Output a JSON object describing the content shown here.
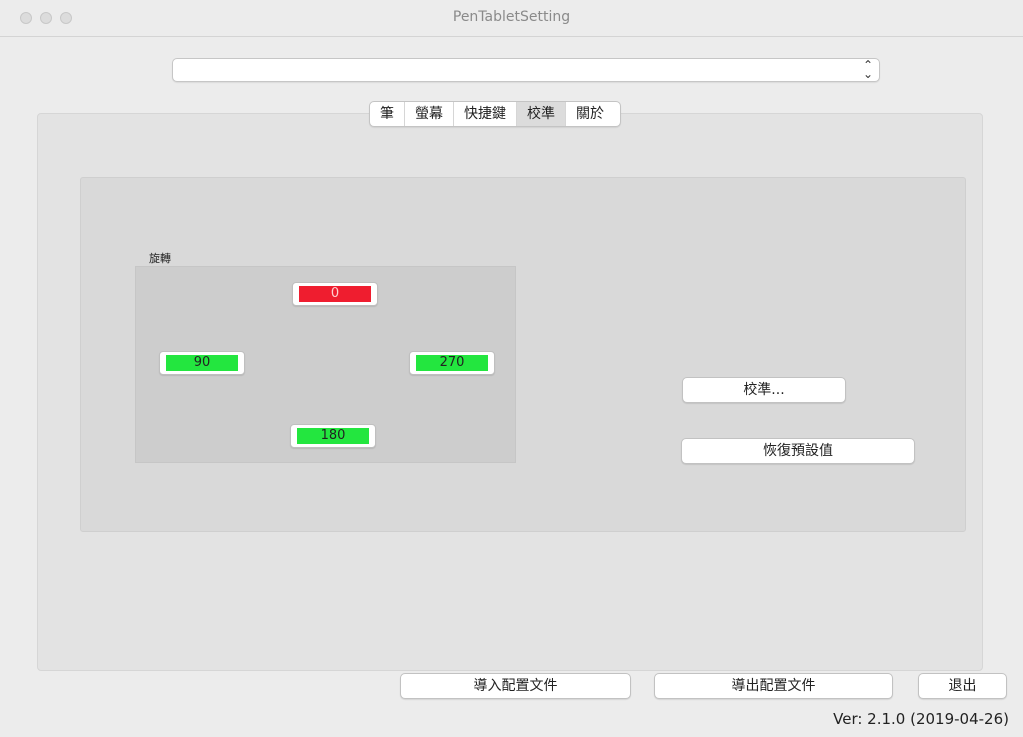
{
  "window": {
    "title": "PenTabletSetting"
  },
  "device_select": {
    "value": "",
    "arrow_icon": "up-down-chevron-icon"
  },
  "tabs": [
    {
      "label": "筆",
      "active": false
    },
    {
      "label": "螢幕",
      "active": false
    },
    {
      "label": "快捷鍵",
      "active": false
    },
    {
      "label": "校準",
      "active": true
    },
    {
      "label": "關於",
      "active": false
    }
  ],
  "rotation": {
    "label": "旋轉",
    "buttons": [
      {
        "value": "0",
        "color": "#ef1d2f",
        "selected": true
      },
      {
        "value": "90",
        "color": "#23e63f",
        "selected": false
      },
      {
        "value": "270",
        "color": "#23e63f",
        "selected": false
      },
      {
        "value": "180",
        "color": "#23e63f",
        "selected": false
      }
    ]
  },
  "calibration": {
    "calibrate_label": "校準...",
    "restore_defaults_label": "恢復預設值"
  },
  "footer": {
    "import_label": "導入配置文件",
    "export_label": "導出配置文件",
    "exit_label": "退出",
    "version": "Ver: 2.1.0 (2019-04-26)"
  }
}
